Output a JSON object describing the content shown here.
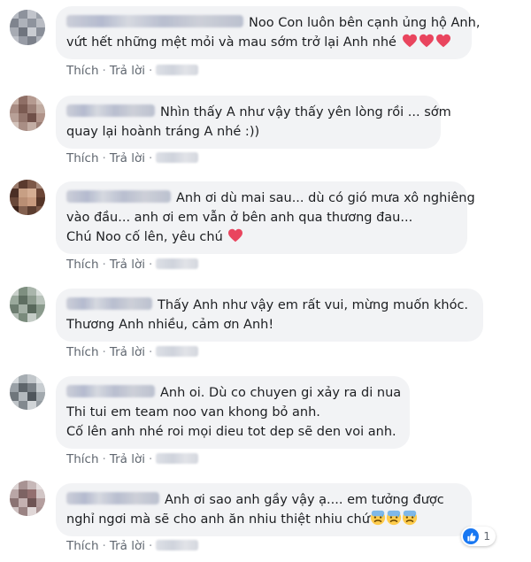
{
  "actions": {
    "like": "Thích",
    "reply": "Trả lời",
    "separator": "·"
  },
  "colors": {
    "bubble_bg": "#f2f3f5",
    "heart": "#e9455e",
    "like_blue": "#1877f2",
    "action_text": "#606770"
  },
  "comments": [
    {
      "lines": [
        "Noo Con luôn bên cạnh ủng hộ Anh,",
        "vứt hết những mệt mỏi và mau sớm trở lại Anh nhé"
      ],
      "emoji": "heart-emoji ×3"
    },
    {
      "lines": [
        "Nhìn thấy A như vậy thấy yên lòng rồi ... sớm",
        "quay lại hoành tráng A nhé :))"
      ]
    },
    {
      "lines": [
        "Anh ơi dù mai sau... dù có gió mưa xô nghiêng",
        "vào đầu... anh ơi em vẫn ở bên anh qua thương đau...",
        "Chú Noo cố lên, yêu chú"
      ],
      "emoji": "heart-emoji"
    },
    {
      "lines": [
        "Thấy Anh như vậy em rất vui, mừng muốn khóc.",
        "Thương Anh nhiều, cảm ơn Anh!"
      ]
    },
    {
      "lines": [
        "Anh oi. Dù co chuyen gi xảy ra di nua",
        "Thi tui em team noo van khong bỏ anh.",
        "Cố lên anh nhé roi mọi dieu tot dep sẽ den voi anh."
      ]
    },
    {
      "lines": [
        "Anh ơi sao anh gầy vậy ạ.... em tưởng được",
        "nghỉ ngơi mà sẽ cho anh ăn nhiu thiệt nhiu chứ"
      ],
      "emoji": "cold-sweat-emoji ×3",
      "reaction": {
        "icon": "like-icon",
        "count": "1"
      }
    }
  ]
}
